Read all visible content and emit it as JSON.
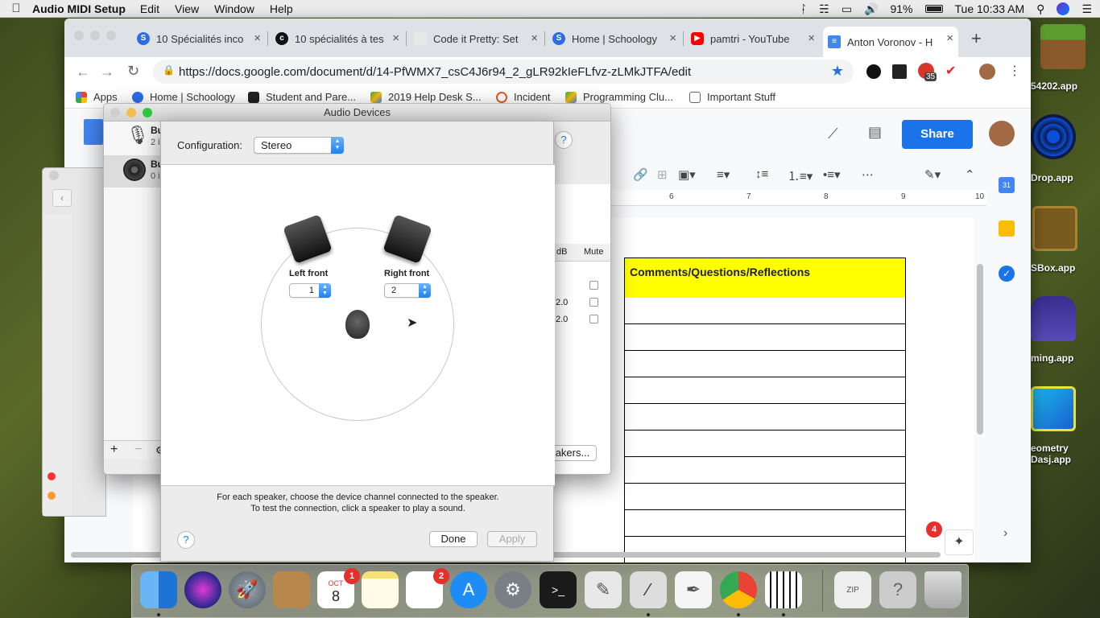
{
  "menubar": {
    "app_name": "Audio MIDI Setup",
    "items": [
      "Edit",
      "View",
      "Window",
      "Help"
    ],
    "battery": "91%",
    "clock": "Tue 10:33 AM"
  },
  "desktop_icons": [
    "54202.app",
    "Drop.app",
    "SBox.app",
    "ming.app",
    "eometry",
    "Dasj.app"
  ],
  "browser": {
    "tabs": [
      {
        "label": "10 Spécialités inco"
      },
      {
        "label": "10 spécialités à tes"
      },
      {
        "label": "Code it Pretty: Set"
      },
      {
        "label": "Home | Schoology"
      },
      {
        "label": "pamtri - YouTube"
      },
      {
        "label": "Anton Voronov - H"
      }
    ],
    "url": "https://docs.google.com/document/d/14-PfWMX7_csC4J6r94_2_gLR92kIeFLfvz-zLMkJTFA/edit",
    "extension_badge": "35",
    "bookmarks": [
      "Apps",
      "Home | Schoology",
      "Student and Pare...",
      "2019 Help Desk S...",
      "Incident",
      "Programming Clu...",
      "Important Stuff"
    ]
  },
  "docs": {
    "share_label": "Share",
    "ruler_ticks": [
      "6",
      "7",
      "8",
      "9",
      "10"
    ],
    "table_header": "Comments/Questions/Reflections",
    "notification_count": "4"
  },
  "audio_window": {
    "title": "Audio Devices",
    "devices": [
      {
        "name": "Bu",
        "detail": "2 i"
      },
      {
        "name": "Bu",
        "detail": "0 i"
      }
    ],
    "column_db": "dB",
    "column_mute": "Mute",
    "values": [
      "2.0",
      "2.0"
    ],
    "speakers_button": "akers..."
  },
  "speaker_sheet": {
    "configuration_label": "Configuration:",
    "configuration_value": "Stereo",
    "left_label": "Left front",
    "left_channel": "1",
    "right_label": "Right front",
    "right_channel": "2",
    "instructions_line1": "For each speaker, choose the device channel connected to the speaker.",
    "instructions_line2": "To test the connection, click a speaker to play a sound.",
    "done_label": "Done",
    "apply_label": "Apply",
    "help_label": "?"
  },
  "dock": {
    "calendar_month": "OCT",
    "calendar_day": "8",
    "calendar_badge": "1",
    "reminders_badge": "2"
  }
}
